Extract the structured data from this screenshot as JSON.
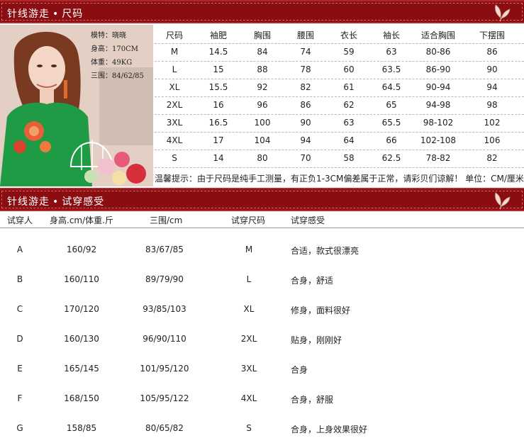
{
  "banner1": {
    "title": "针线游走",
    "dot": "•",
    "subtitle": "尺码"
  },
  "banner2": {
    "title": "针线游走",
    "dot": "•",
    "subtitle": "试穿感受"
  },
  "model": {
    "lines": [
      "模特：晓晓",
      "身高：170CM",
      "体重：49KG",
      "三围：84/62/85"
    ]
  },
  "size_table": {
    "headers": [
      "尺码",
      "袖肥",
      "胸围",
      "腰围",
      "衣长",
      "袖长",
      "适合胸围",
      "下摆围"
    ],
    "rows": [
      [
        "M",
        "14.5",
        "84",
        "74",
        "59",
        "63",
        "80-86",
        "86"
      ],
      [
        "L",
        "15",
        "88",
        "78",
        "60",
        "63.5",
        "86-90",
        "90"
      ],
      [
        "XL",
        "15.5",
        "92",
        "82",
        "61",
        "64.5",
        "90-94",
        "94"
      ],
      [
        "2XL",
        "16",
        "96",
        "86",
        "62",
        "65",
        "94-98",
        "98"
      ],
      [
        "3XL",
        "16.5",
        "100",
        "90",
        "63",
        "65.5",
        "98-102",
        "102"
      ],
      [
        "4XL",
        "17",
        "104",
        "94",
        "64",
        "66",
        "102-108",
        "106"
      ],
      [
        "S",
        "14",
        "80",
        "70",
        "58",
        "62.5",
        "78-82",
        "82"
      ]
    ],
    "tip": "温馨提示：由于尺码是纯手工测量，有正负1-3CM偏差属于正常，请彩贝们谅解！ 单位：CM/厘米"
  },
  "try_table": {
    "headers": [
      "试穿人",
      "身高.cm/体重.斤",
      "三围/cm",
      "试穿尺码",
      "试穿感受"
    ],
    "rows": [
      [
        "A",
        "160/92",
        "83/67/85",
        "M",
        "合适，款式很漂亮"
      ],
      [
        "B",
        "160/110",
        "89/79/90",
        "L",
        "合身，舒适"
      ],
      [
        "C",
        "170/120",
        "93/85/103",
        "XL",
        "修身，面料很好"
      ],
      [
        "D",
        "160/130",
        "96/90/110",
        "2XL",
        "贴身，刚刚好"
      ],
      [
        "E",
        "165/145",
        "101/95/120",
        "3XL",
        "合身"
      ],
      [
        "F",
        "168/150",
        "105/95/122",
        "4XL",
        "合身，舒服"
      ],
      [
        "G",
        "158/85",
        "80/65/82",
        "S",
        "合身，上身效果很好"
      ]
    ]
  },
  "colors": {
    "banner": "#8a0d12",
    "banner_border": "#b3262a",
    "dress": "#1f9a45"
  },
  "icons": [
    "leaf-ornament-icon"
  ]
}
